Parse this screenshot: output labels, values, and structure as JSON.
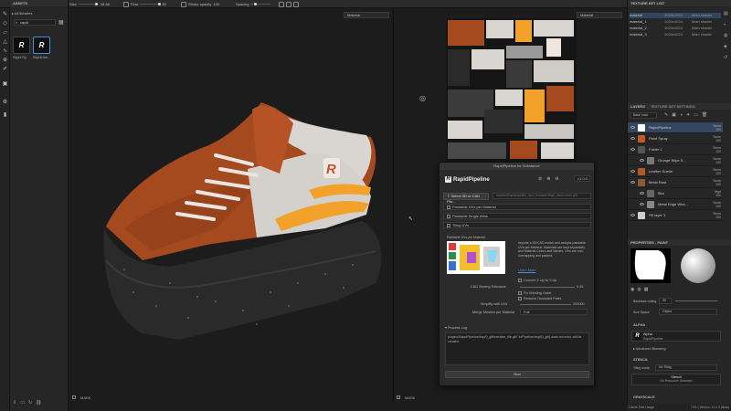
{
  "topbar": {
    "size_label": "Size",
    "size_value": "35.88",
    "flow_label": "Flow",
    "flow_value": "50",
    "stroke_opacity_label": "Stroke opacity",
    "stroke_opacity_value": "100",
    "spacing_label": "Spacing"
  },
  "assets": {
    "title": "ASSETS",
    "breadcrumb": "All libraries",
    "search_value": "rapid",
    "items": [
      {
        "glyph": "R",
        "caption": "Rapid Pip"
      },
      {
        "glyph": "R",
        "caption": "RapidUser..."
      }
    ]
  },
  "viewport3d": {
    "mode": "Material",
    "footer_label": "MASK"
  },
  "viewport2d": {
    "mode": "Material",
    "footer_label": "MASK"
  },
  "texture_set_list": {
    "title": "TEXTURE SET LIST",
    "rows": [
      {
        "name": "material",
        "size": "1024x1024",
        "shader": "Main shader"
      },
      {
        "name": "material_1",
        "size": "1024x1024",
        "shader": "Main shader"
      },
      {
        "name": "material_2",
        "size": "1024x1024",
        "shader": "Main shader"
      },
      {
        "name": "material_3",
        "size": "1024x1024",
        "shader": "Main shader"
      }
    ]
  },
  "layers": {
    "tab1": "LAYERS",
    "tab2": "TEXTURE SET SETTINGS",
    "base_color": "Base color",
    "rows": [
      {
        "name": "RapidPipeline",
        "blend": "Norm",
        "opacity": "100",
        "thumb": "#ffffff"
      },
      {
        "name": "Paint Spray",
        "blend": "Norm",
        "opacity": "100",
        "thumb": "#c05a2a"
      },
      {
        "name": "Folder 1",
        "blend": "Norm",
        "opacity": "100",
        "thumb": "#555555"
      },
      {
        "name": "Grunge Wipe S...",
        "blend": "Norm",
        "opacity": "100",
        "thumb": "#777777"
      },
      {
        "name": "Leather Suede",
        "blend": "Norm",
        "opacity": "100",
        "thumb": "#b05a2a"
      },
      {
        "name": "Metal Rust",
        "blend": "Norm",
        "opacity": "100",
        "thumb": "#8a5a3a"
      },
      {
        "name": "Blur",
        "blend": "Mgd",
        "opacity": "100",
        "thumb": "#666666"
      },
      {
        "name": "Metal Edge Wea...",
        "blend": "Norm",
        "opacity": "100",
        "thumb": "#888888"
      },
      {
        "name": "Fill layer 3",
        "blend": "Norm",
        "opacity": "100",
        "thumb": "#cfcfcf"
      }
    ]
  },
  "properties": {
    "title": "PROPERTIES - PAINT",
    "backface_label": "Backface culling",
    "backface_value": "90",
    "size_space_label": "Size Space",
    "size_space_value": "Object",
    "alpha_header": "ALPHA",
    "alpha_name": "Alpha",
    "alpha_sub": "RapidPipeline",
    "advanced_blending": "Advanced Blending",
    "stencil_header": "STENCIL",
    "tiling_label": "Tiling mode",
    "tiling_value": "No Tiling",
    "stencil_label": "Stencil",
    "stencil_sub": "No Resource Selected",
    "grayscale_header": "GRAYSCALE"
  },
  "statusbar": {
    "cache": "Cache Disk Usage",
    "version": "73% | Version: 11.0.3 (Beta)"
  },
  "rapidpipeline": {
    "window_title": "RapidPipeline for Substance",
    "logo_text": "RapidPipeline",
    "version": "v1.0.0",
    "select_label": "Select 3D or CAD File...",
    "file_path": "/assets/Rapidpipeline_dyn_Sneaker/High_shoe.mesh.glb",
    "option1": "Paintable UVs per Material",
    "option2": "Paintable Single Atlas",
    "option3": "Tiling UVs",
    "preview_caption": "Paintable UVs per Material",
    "description": "Imports a 3D/CAD model and assigns paintable UVs per Material. Materials are kept separately and Material Colors and Names. UVs are non-overlapping and packed.",
    "learn_more": "Learn More",
    "convert_label": "Convert Z-Up to Y-Up",
    "cad_tolerance_label": "CAD Sewing Tolerance",
    "cad_tolerance_value": "0.25",
    "fix_winding_label": "Fix Winding Order",
    "remove_occluded_label": "Remove Occluded Parts",
    "simplify_label": "Simplify with UVs",
    "simplify_value": "200000",
    "merge_label": "Merge Meshes per Material",
    "merge_value": "Full",
    "process_log_label": "Process Log",
    "log_text": "plugins/RapidPipeline/tmp/0_gltf/sneaker_file.glb\" in/Pipeline/tmp/[0_glb] does not exist, will be created.",
    "run_label": "Run"
  },
  "colors": {
    "accent": "#4a8fd6",
    "leather": "#a5491f",
    "orange": "#f2a12a",
    "sole": "#2a2a2a"
  }
}
